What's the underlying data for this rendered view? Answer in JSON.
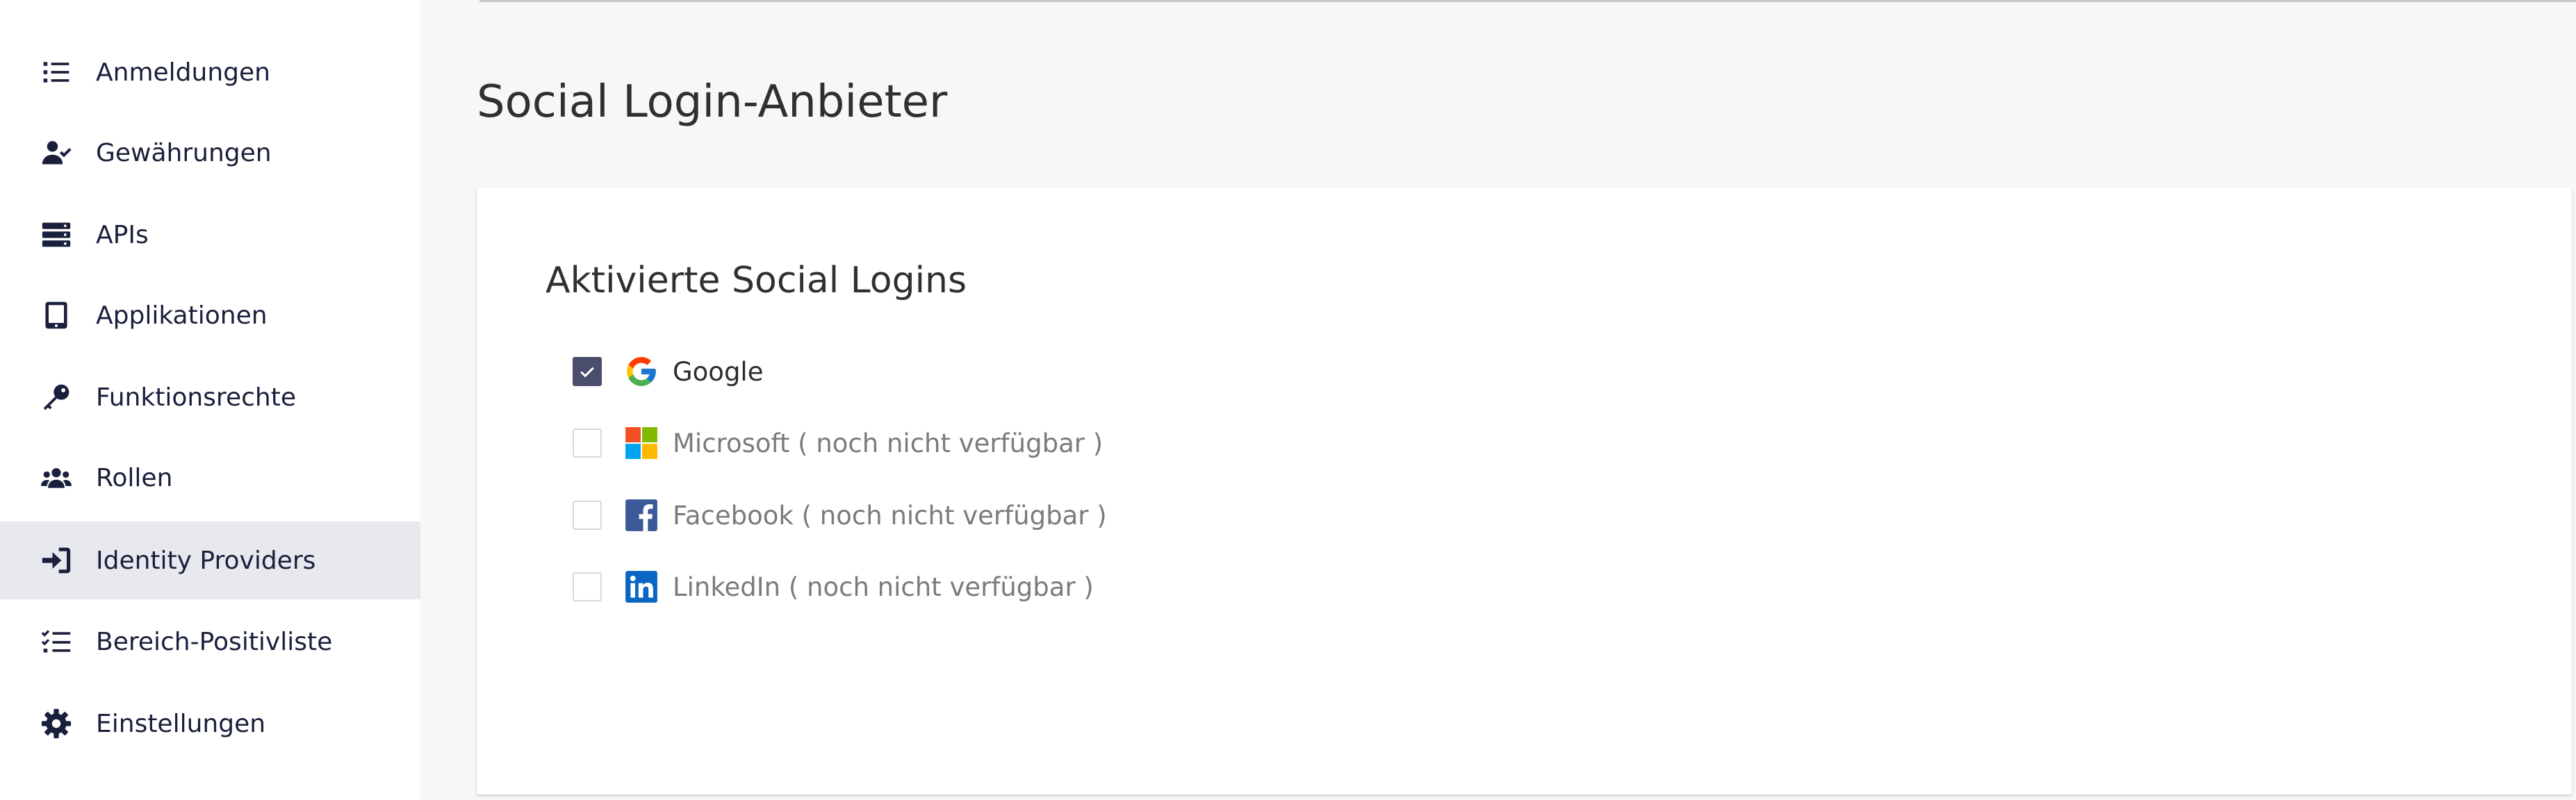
{
  "sidebar": {
    "items": [
      {
        "label": "Anmeldungen",
        "icon": "list-icon",
        "active": false
      },
      {
        "label": "Gewährungen",
        "icon": "user-check-icon",
        "active": false
      },
      {
        "label": "APIs",
        "icon": "server-icon",
        "active": false
      },
      {
        "label": "Applikationen",
        "icon": "tablet-icon",
        "active": false
      },
      {
        "label": "Funktionsrechte",
        "icon": "key-icon",
        "active": false
      },
      {
        "label": "Rollen",
        "icon": "users-icon",
        "active": false
      },
      {
        "label": "Identity Providers",
        "icon": "sign-in-icon",
        "active": true
      },
      {
        "label": "Bereich-Positivliste",
        "icon": "checklist-icon",
        "active": false
      },
      {
        "label": "Einstellungen",
        "icon": "gear-icon",
        "active": false
      }
    ]
  },
  "page": {
    "title": "Social Login-Anbieter"
  },
  "card": {
    "title": "Aktivierte Social Logins",
    "providers": [
      {
        "label": "Google",
        "checked": true,
        "available": true,
        "icon": "google-icon"
      },
      {
        "label": "Microsoft ( noch nicht verfügbar )",
        "checked": false,
        "available": false,
        "icon": "microsoft-icon"
      },
      {
        "label": "Facebook ( noch nicht verfügbar )",
        "checked": false,
        "available": false,
        "icon": "facebook-icon"
      },
      {
        "label": "LinkedIn ( noch nicht verfügbar )",
        "checked": false,
        "available": false,
        "icon": "linkedin-icon"
      }
    ]
  },
  "colors": {
    "navy": "#1a1f3c",
    "active_bg": "#e8e9ee",
    "checkbox_checked": "#4a4d6b",
    "page_bg": "#f7f7f7"
  }
}
